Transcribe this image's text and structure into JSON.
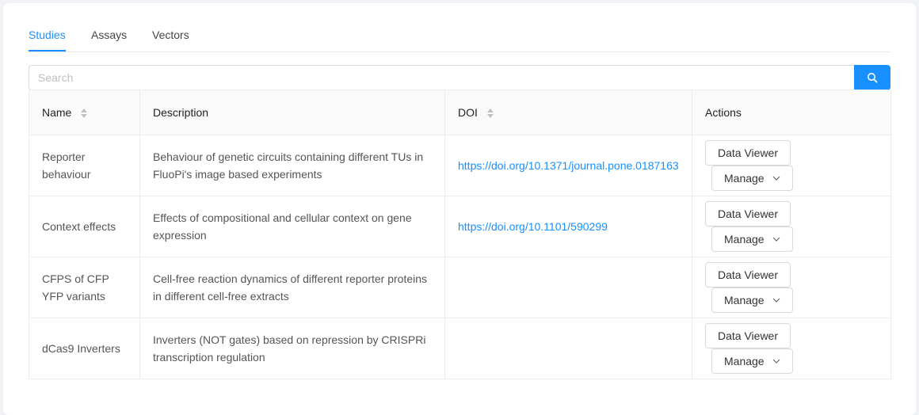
{
  "tabs": [
    {
      "label": "Studies",
      "active": true
    },
    {
      "label": "Assays",
      "active": false
    },
    {
      "label": "Vectors",
      "active": false
    }
  ],
  "search": {
    "placeholder": "Search",
    "value": ""
  },
  "table": {
    "columns": {
      "name": "Name",
      "description": "Description",
      "doi": "DOI",
      "actions": "Actions"
    },
    "rows": [
      {
        "name": "Reporter behaviour",
        "description": "Behaviour of genetic circuits containing different TUs in FluoPi's image based experiments",
        "doi": "https://doi.org/10.1371/journal.pone.0187163",
        "data_viewer": "Data Viewer",
        "manage": "Manage"
      },
      {
        "name": "Context effects",
        "description": "Effects of compositional and cellular context on gene expression",
        "doi": "https://doi.org/10.1101/590299",
        "data_viewer": "Data Viewer",
        "manage": "Manage"
      },
      {
        "name": "CFPS of CFP YFP variants",
        "description": "Cell-free reaction dynamics of different reporter proteins in different cell-free extracts",
        "doi": "",
        "data_viewer": "Data Viewer",
        "manage": "Manage"
      },
      {
        "name": "dCas9 Inverters",
        "description": "Inverters (NOT gates) based on repression by CRISPRi transcription regulation",
        "doi": "",
        "data_viewer": "Data Viewer",
        "manage": "Manage"
      }
    ]
  },
  "colors": {
    "accent": "#1890ff",
    "border": "#ececec",
    "header_bg": "#fafafa"
  },
  "icons": {
    "search": "search-icon",
    "sort": "sort-icon",
    "dropdown": "chevron-down-icon"
  }
}
